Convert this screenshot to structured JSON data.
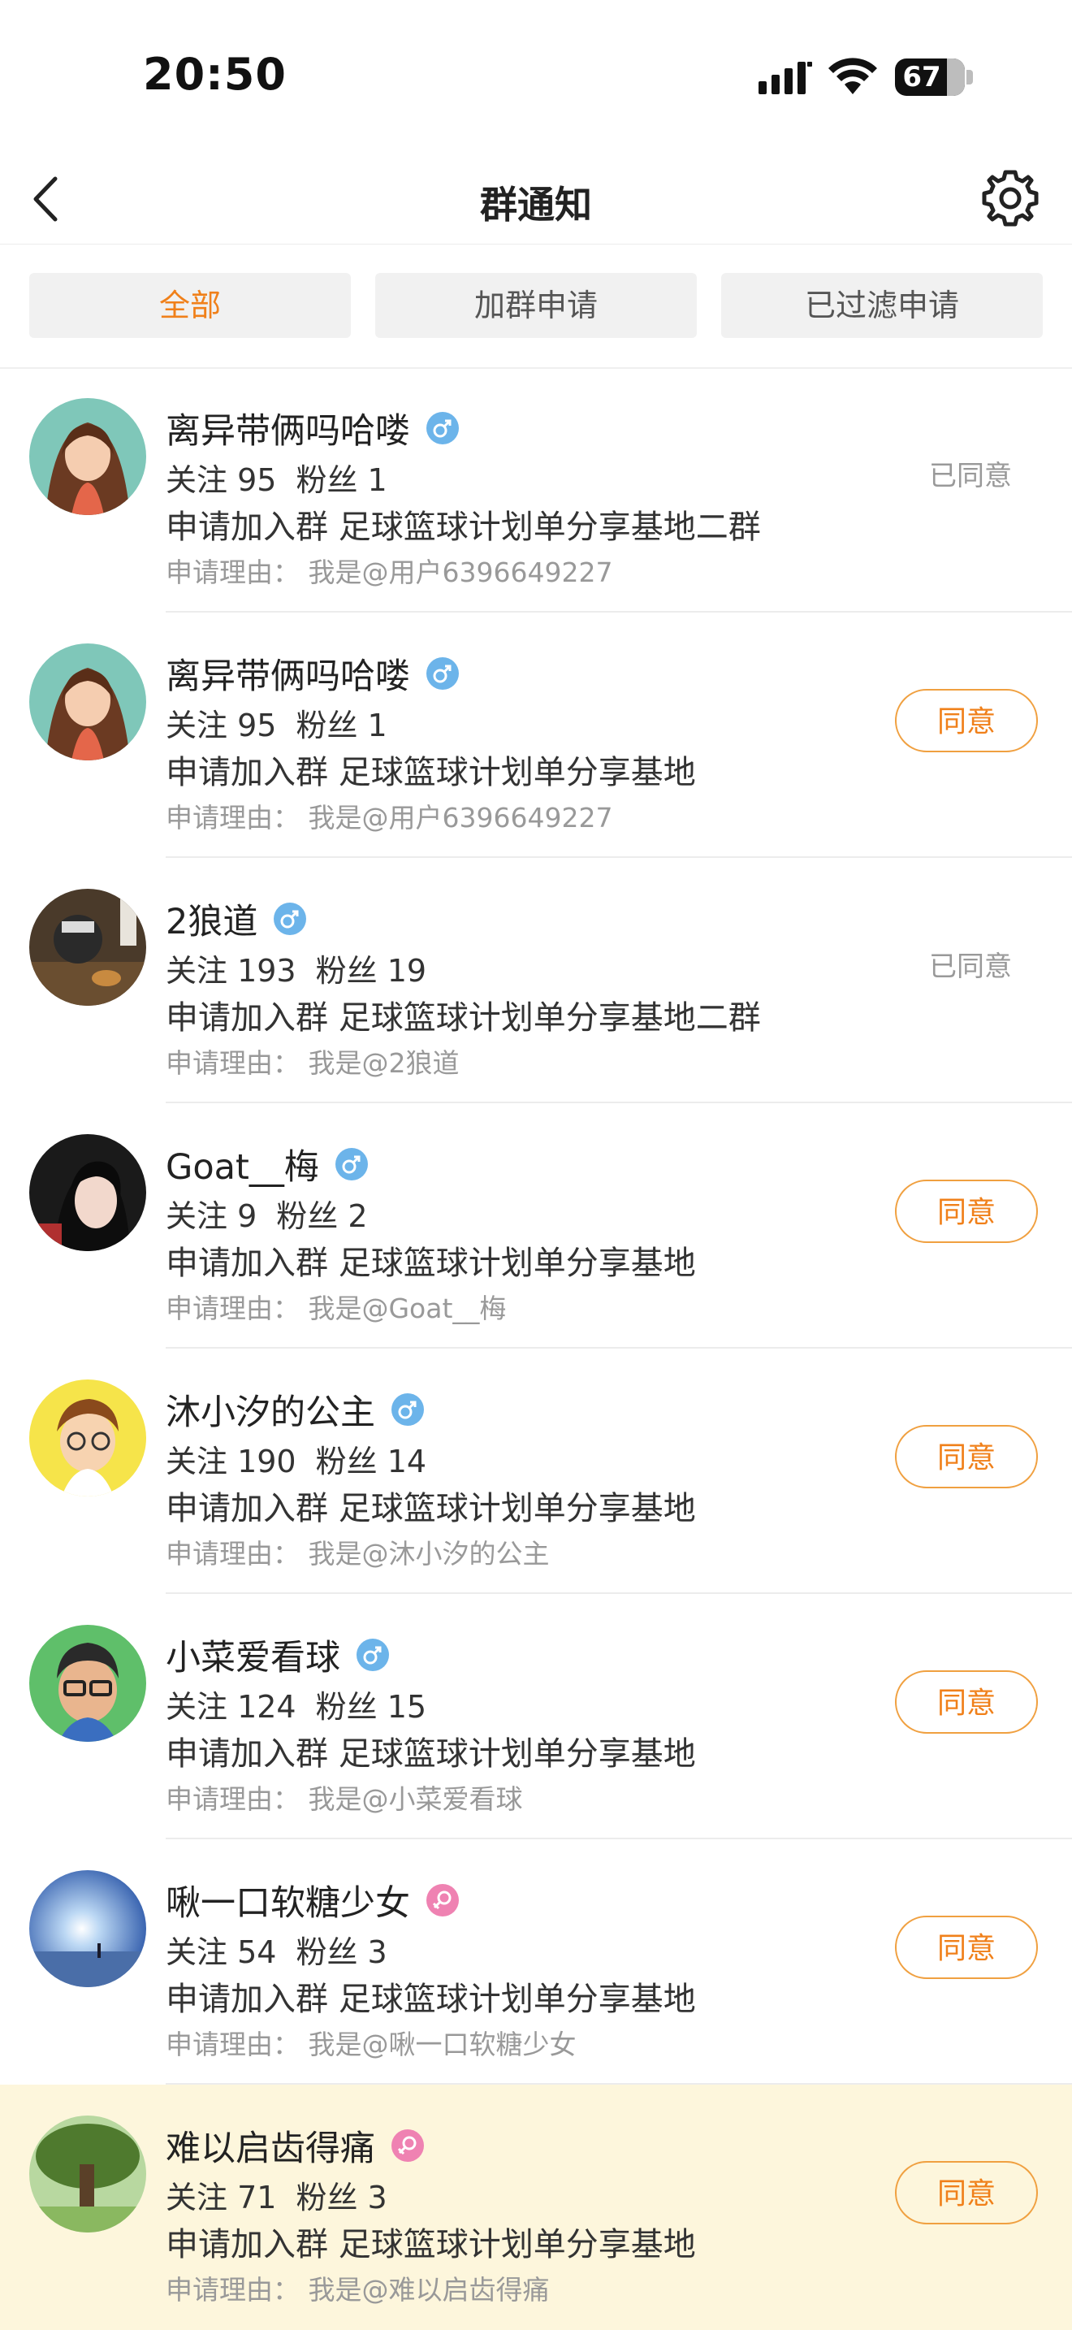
{
  "status_bar": {
    "time": "20:50",
    "battery": "67"
  },
  "header": {
    "title": "群通知"
  },
  "tabs": [
    {
      "label": "全部"
    },
    {
      "label": "加群申请"
    },
    {
      "label": "已过滤申请"
    }
  ],
  "colors": {
    "accent": "#f0801a",
    "male": "#6cb4ea",
    "female": "#ef82b2",
    "highlight": "#fdf6dc"
  },
  "requests": [
    {
      "name": "离异带俩吗哈喽",
      "gender": "male",
      "follow": "关注 95",
      "fans": "粉丝 1",
      "apply": "申请加入群 足球篮球计划单分享基地二群",
      "reason": "申请理由：  我是@用户6396649227",
      "status": "已同意"
    },
    {
      "name": "离异带俩吗哈喽",
      "gender": "male",
      "follow": "关注 95",
      "fans": "粉丝 1",
      "apply": "申请加入群 足球篮球计划单分享基地",
      "reason": "申请理由：  我是@用户6396649227",
      "action": "同意"
    },
    {
      "name": "2狼道",
      "gender": "male",
      "follow": "关注 193",
      "fans": "粉丝 19",
      "apply": "申请加入群 足球篮球计划单分享基地二群",
      "reason": "申请理由：  我是@2狼道",
      "status": "已同意"
    },
    {
      "name": "Goat__梅",
      "gender": "male",
      "follow": "关注 9",
      "fans": "粉丝 2",
      "apply": "申请加入群 足球篮球计划单分享基地",
      "reason": "申请理由：  我是@Goat__梅",
      "action": "同意"
    },
    {
      "name": "沐小汐的公主",
      "gender": "male",
      "follow": "关注 190",
      "fans": "粉丝 14",
      "apply": "申请加入群 足球篮球计划单分享基地",
      "reason": "申请理由：  我是@沐小汐的公主",
      "action": "同意"
    },
    {
      "name": "小菜爱看球",
      "gender": "male",
      "follow": "关注 124",
      "fans": "粉丝 15",
      "apply": "申请加入群 足球篮球计划单分享基地",
      "reason": "申请理由：  我是@小菜爱看球",
      "action": "同意"
    },
    {
      "name": "啾一口软糖少女",
      "gender": "female",
      "follow": "关注 54",
      "fans": "粉丝 3",
      "apply": "申请加入群 足球篮球计划单分享基地",
      "reason": "申请理由：  我是@啾一口软糖少女",
      "action": "同意"
    },
    {
      "name": "难以启齿得痛",
      "gender": "female",
      "follow": "关注 71",
      "fans": "粉丝 3",
      "apply": "申请加入群 足球篮球计划单分享基地",
      "reason": "申请理由：  我是@难以启齿得痛",
      "action": "同意"
    }
  ]
}
